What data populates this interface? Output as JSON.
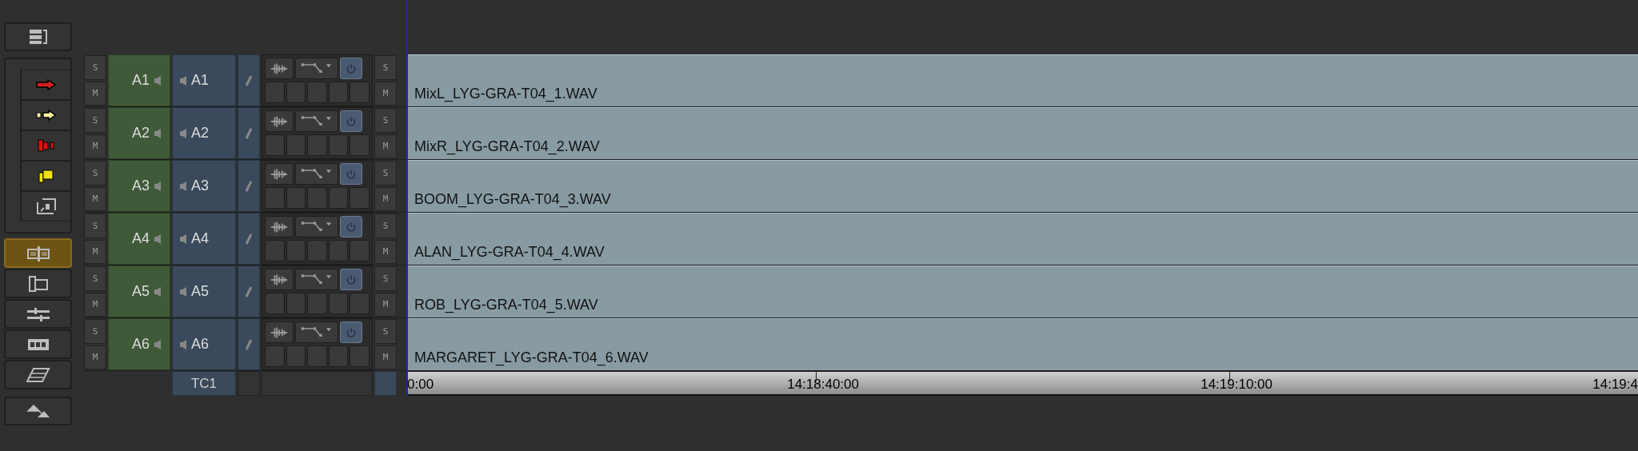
{
  "toolbar": {
    "lower_buttons": [
      {
        "selected": true
      },
      {
        "selected": false
      },
      {
        "selected": false
      },
      {
        "selected": false
      },
      {
        "selected": false
      }
    ]
  },
  "tracks": [
    {
      "solo": "S",
      "mute": "M",
      "source": "A1",
      "record": "A1",
      "out_solo": "S",
      "out_mute": "M",
      "clip": "MixL_LYG-GRA-T04_1.WAV"
    },
    {
      "solo": "S",
      "mute": "M",
      "source": "A2",
      "record": "A2",
      "out_solo": "S",
      "out_mute": "M",
      "clip": "MixR_LYG-GRA-T04_2.WAV"
    },
    {
      "solo": "S",
      "mute": "M",
      "source": "A3",
      "record": "A3",
      "out_solo": "S",
      "out_mute": "M",
      "clip": "BOOM_LYG-GRA-T04_3.WAV"
    },
    {
      "solo": "S",
      "mute": "M",
      "source": "A4",
      "record": "A4",
      "out_solo": "S",
      "out_mute": "M",
      "clip": "ALAN_LYG-GRA-T04_4.WAV"
    },
    {
      "solo": "S",
      "mute": "M",
      "source": "A5",
      "record": "A5",
      "out_solo": "S",
      "out_mute": "M",
      "clip": "ROB_LYG-GRA-T04_5.WAV"
    },
    {
      "solo": "S",
      "mute": "M",
      "source": "A6",
      "record": "A6",
      "out_solo": "S",
      "out_mute": "M",
      "clip": "MARGARET_LYG-GRA-T04_6.WAV"
    }
  ],
  "timecode_track": "TC1",
  "ruler": [
    "0:00",
    "14:18:40:00",
    "14:19:10:00",
    "14:19:4"
  ]
}
